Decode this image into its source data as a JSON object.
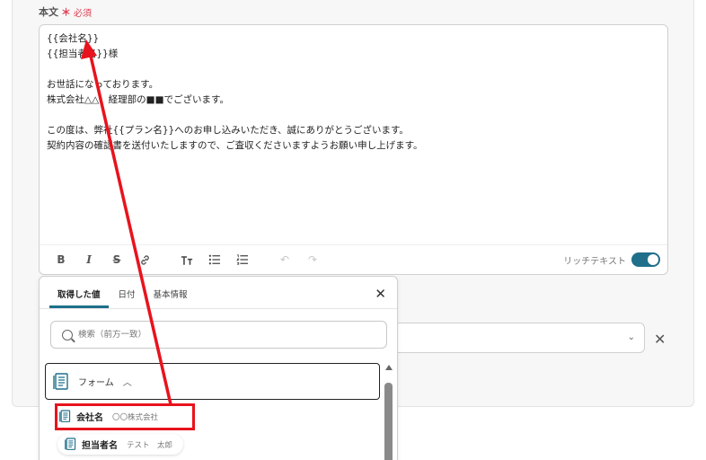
{
  "field": {
    "label": "本文",
    "star": "＊",
    "required": "必須"
  },
  "editor": {
    "lines": [
      "{{会社名}}",
      "{{担当者名}}様",
      "",
      "お世話になっております。",
      "株式会社△△　経理部の■■でございます。",
      "",
      "この度は、弊社{{プラン名}}へのお申し込みいただき、誠にありがとうございます。",
      "契約内容の確認書を送付いたしますので、ご査収くださいますようお願い申し上げます。"
    ],
    "rich_text_label": "リッチテキスト",
    "rich_text_enabled": true
  },
  "toolbar": {
    "bold": "B",
    "italic": "I",
    "strike": "S",
    "link": "🔗",
    "text_format": "T",
    "bullet_list": "☰",
    "numbered_list": "☰",
    "undo": "↶",
    "redo": "↷"
  },
  "popup": {
    "tabs": [
      "取得した値",
      "日付",
      "基本情報"
    ],
    "active_tab": "取得した値",
    "search_placeholder": "検索（前方一致）",
    "group": {
      "label": "フォーム",
      "expanded": true
    },
    "items": [
      {
        "name": "会社名",
        "sample": "〇〇株式会社"
      },
      {
        "name": "担当者名",
        "sample": "テスト　太郎"
      }
    ]
  },
  "colors": {
    "accent": "#1f6f8b",
    "required": "#e03e52",
    "annotation_red": "#e8131d"
  }
}
